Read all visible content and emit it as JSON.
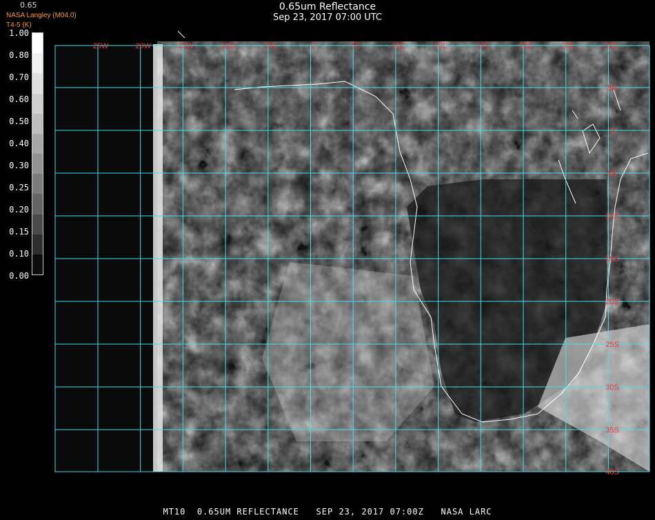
{
  "title": "0.65um Reflectance",
  "subtitle": "Sep 23, 2017 07:00 UTC",
  "credit_line1": "NASA Langley (M04.0)",
  "credit_line2": "T4-5 (K)",
  "scale_top_label": "0.65",
  "colorbar": {
    "labels": [
      "1.00",
      "0.80",
      "0.70",
      "0.60",
      "0.50",
      "0.40",
      "0.30",
      "0.25",
      "0.20",
      "0.15",
      "0.10",
      "0.00"
    ],
    "colors": [
      "#ffffff",
      "#f0f0f0",
      "#e0e0e0",
      "#cfcfcf",
      "#bdbdbd",
      "#a8a8a8",
      "#939393",
      "#7c7c7c",
      "#646464",
      "#4a4a4a",
      "#2e2e2e",
      "#0c0c0c"
    ]
  },
  "grid": {
    "color": "#40e0f0",
    "label_color": "#ff3030",
    "longitude_labels": [
      "25W",
      "20W",
      "15W",
      "10W",
      "5W",
      "0",
      "5E",
      "10E",
      "15E",
      "20E",
      "25E",
      "30E",
      "35E"
    ],
    "latitude_labels": [
      "5N",
      "0",
      "5S",
      "10S",
      "15S",
      "20S",
      "25S",
      "30S",
      "35S",
      "40S"
    ]
  },
  "footer": "MT10  0.65UM REFLECTANCE   SEP 23, 2017 07:00Z   NASA LARC"
}
